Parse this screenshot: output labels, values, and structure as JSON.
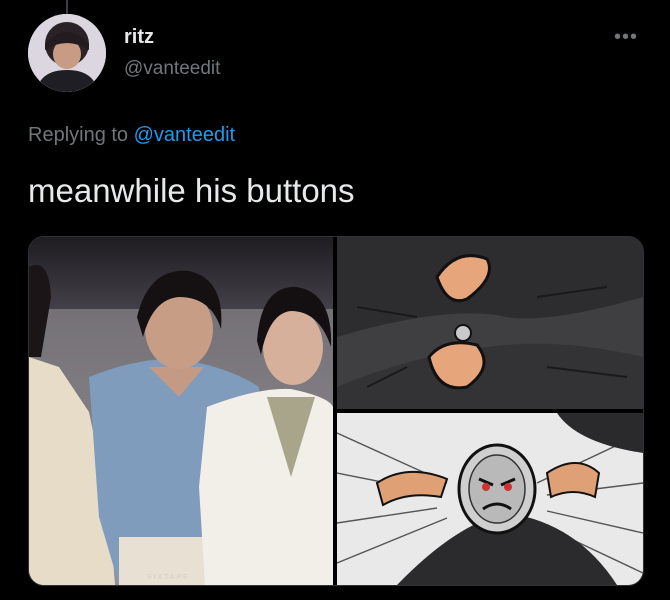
{
  "tweet": {
    "display_name": "ritz",
    "handle": "@vanteedit",
    "more_icon": "more-horizontal-icon",
    "replying_prefix": "Replying to",
    "replying_handle": "@vanteedit",
    "text": "meanwhile his buttons"
  },
  "media": {
    "photo_watermark": "SIXTAPE"
  },
  "colors": {
    "background": "#000000",
    "primary_text": "#e7e9ea",
    "secondary_text": "#71767b",
    "link": "#1d9bf0"
  }
}
